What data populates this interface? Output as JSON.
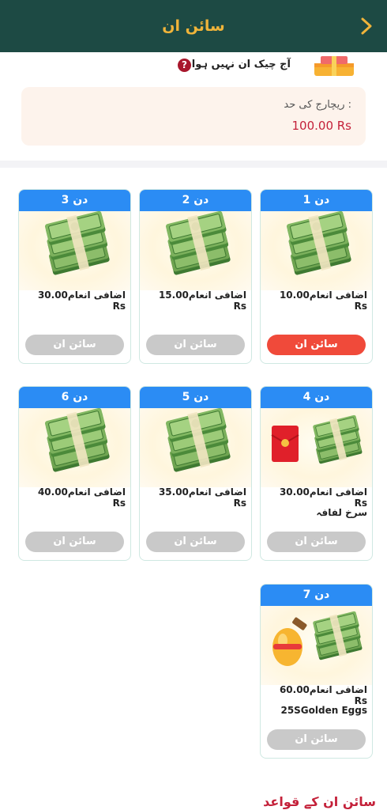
{
  "header": {
    "title": "سائن ان"
  },
  "status": {
    "text": "آج چیک ان نہیں ہوا",
    "help_glyph": "?"
  },
  "recharge": {
    "label": "ریچارج کی حد  :",
    "value": "100.00 Rs"
  },
  "cards": [
    {
      "day": "دن 1",
      "reward": "اضافی انعام10.00 Rs",
      "extra": "",
      "button": "سائن ان",
      "active": true,
      "image": "cash-stack-icon"
    },
    {
      "day": "دن 2",
      "reward": "اضافی انعام15.00 Rs",
      "extra": "",
      "button": "سائن ان",
      "active": false,
      "image": "cash-stack-icon"
    },
    {
      "day": "دن 3",
      "reward": "اضافی انعام30.00 Rs",
      "extra": "",
      "button": "سائن ان",
      "active": false,
      "image": "cash-stack-icon"
    },
    {
      "day": "دن 4",
      "reward": "اضافی انعام30.00 Rs",
      "extra": "سرخ لفافہ",
      "button": "سائن ان",
      "active": false,
      "image": "red-envelope-and-cash-icon"
    },
    {
      "day": "دن 5",
      "reward": "اضافی انعام35.00 Rs",
      "extra": "",
      "button": "سائن ان",
      "active": false,
      "image": "cash-stack-icon"
    },
    {
      "day": "دن 6",
      "reward": "اضافی انعام40.00 Rs",
      "extra": "",
      "button": "سائن ان",
      "active": false,
      "image": "cash-stack-icon"
    },
    {
      "day": "دن 7",
      "reward": "اضافی انعام60.00 Rs",
      "extra": "25SGolden Eggs",
      "button": "سائن ان",
      "active": false,
      "image": "golden-egg-and-cash-icon"
    }
  ],
  "rules": {
    "title": "سائن ان کے قواعد"
  },
  "colors": {
    "header_bg": "#1d4a44",
    "header_text": "#f0b43a",
    "card_head": "#2b8cf4",
    "active_button": "#f04a3a",
    "inactive_button": "#c9c9c9",
    "accent_red": "#c4213a"
  }
}
